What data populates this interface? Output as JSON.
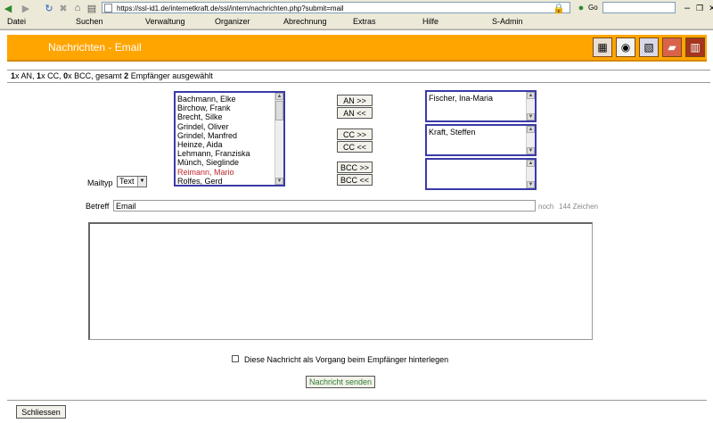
{
  "browser": {
    "url": "https://ssl-id1.de/internetkraft.de/ssl/intern/nachrichten.php?submit=mail",
    "go_label": "Go"
  },
  "menu": [
    "Datei",
    "Suchen",
    "Verwaltung",
    "Organizer",
    "Abrechnung",
    "Extras",
    "Hilfe",
    "S-Admin"
  ],
  "header": {
    "title": "Nachrichten - Email"
  },
  "recipients": {
    "an_count": "1",
    "an_label": "x AN,",
    "cc_count": "1",
    "cc_label": "x CC,",
    "bcc_count": "0",
    "bcc_label": "x BCC,",
    "gesamt_label": "gesamt",
    "total": "2",
    "suffix": "Empfänger ausgewählt"
  },
  "contacts": [
    "Bachmann, Elke",
    "Birchow, Frank",
    "Brecht, Silke",
    "Grindel, Oliver",
    "Grindel, Manfred",
    "Heinze, Aida",
    "Lehmann, Franziska",
    "Münch, Sieglinde",
    "Reimann, Mario",
    "Rolfes, Gerd"
  ],
  "buttons": {
    "an_add": "AN >>",
    "an_remove": "AN <<",
    "cc_add": "CC >>",
    "cc_remove": "CC <<",
    "bcc_add": "BCC >>",
    "bcc_remove": "BCC <<",
    "send": "Nachricht senden",
    "close": "Schliessen"
  },
  "selected": {
    "an": "Fischer, Ina-Maria",
    "cc": "Kraft, Steffen",
    "bcc": ""
  },
  "mailtyp": {
    "label": "Mailtyp",
    "value": "Text"
  },
  "betreff": {
    "label": "Betreff",
    "value": "Email",
    "noch": "noch",
    "chars": "144 Zeichen"
  },
  "vorgang_label": "Diese Nachricht als Vorgang beim Empfänger hinterlegen",
  "colors": {
    "banner": "#ffa500",
    "listbox_border": "#3a3aa8",
    "highlight_contact": "#c0282d",
    "send_text": "#2e7d32"
  }
}
